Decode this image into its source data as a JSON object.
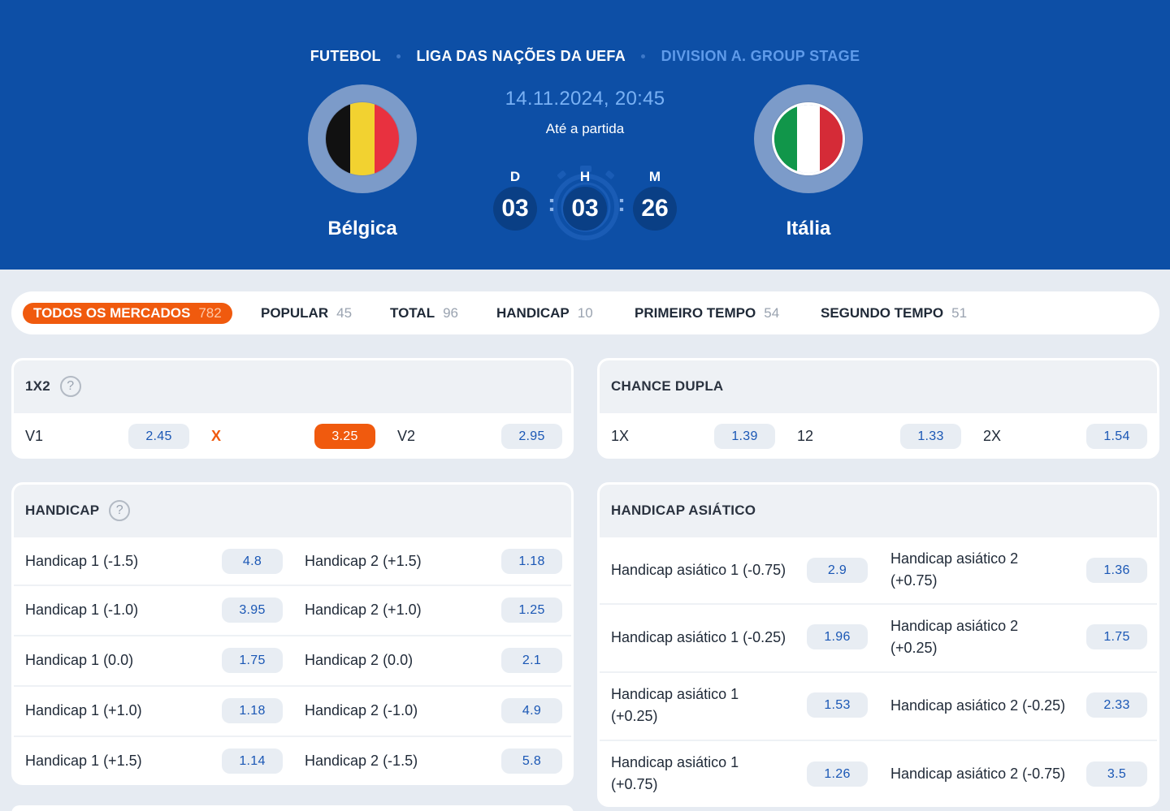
{
  "breadcrumb": [
    "FUTEBOL",
    "LIGA DAS NAÇÕES DA UEFA",
    "DIVISION A. GROUP STAGE"
  ],
  "match": {
    "datetime": "14.11.2024, 20:45",
    "until_label": "Até a partida",
    "home": {
      "name": "Bélgica",
      "flag_colors": [
        "#111111",
        "#f2d230",
        "#e8313f"
      ]
    },
    "away": {
      "name": "Itália",
      "flag_colors": [
        "#11964a",
        "#ffffff",
        "#d52b37"
      ]
    },
    "countdown": {
      "d_label": "D",
      "h_label": "H",
      "m_label": "M",
      "days": "03",
      "hours": "03",
      "minutes": "26",
      "separator": ":"
    }
  },
  "tabs": [
    {
      "label": "TODOS OS MERCADOS",
      "count": "782",
      "active": true
    },
    {
      "label": "POPULAR",
      "count": "45"
    },
    {
      "label": "TOTAL",
      "count": "96"
    },
    {
      "label": "HANDICAP",
      "count": "10"
    },
    {
      "label": "PRIMEIRO TEMPO",
      "count": "54"
    },
    {
      "label": "SEGUNDO TEMPO",
      "count": "51"
    }
  ],
  "markets": {
    "m1x2": {
      "title": "1X2",
      "help": "?",
      "outcomes": [
        {
          "label": "V1",
          "odd": "2.45"
        },
        {
          "label": "X",
          "odd": "3.25"
        },
        {
          "label": "V2",
          "odd": "2.95"
        }
      ]
    },
    "chance_dupla": {
      "title": "CHANCE DUPLA",
      "outcomes": [
        {
          "label": "1X",
          "odd": "1.39"
        },
        {
          "label": "12",
          "odd": "1.33"
        },
        {
          "label": "2X",
          "odd": "1.54"
        }
      ]
    },
    "handicap": {
      "title": "HANDICAP",
      "help": "?",
      "rows": [
        {
          "l": "Handicap 1 (-1.5)",
          "lo": "4.8",
          "r": "Handicap 2 (+1.5)",
          "ro": "1.18"
        },
        {
          "l": "Handicap 1 (-1.0)",
          "lo": "3.95",
          "r": "Handicap 2 (+1.0)",
          "ro": "1.25"
        },
        {
          "l": "Handicap 1 (0.0)",
          "lo": "1.75",
          "r": "Handicap 2 (0.0)",
          "ro": "2.1"
        },
        {
          "l": "Handicap 1 (+1.0)",
          "lo": "1.18",
          "r": "Handicap 2 (-1.0)",
          "ro": "4.9"
        },
        {
          "l": "Handicap 1 (+1.5)",
          "lo": "1.14",
          "r": "Handicap 2 (-1.5)",
          "ro": "5.8"
        }
      ]
    },
    "handicap_asiatico": {
      "title": "HANDICAP ASIÁTICO",
      "rows": [
        {
          "l": "Handicap asiático 1 (-0.75)",
          "lo": "2.9",
          "r1": "Handicap asiático 2",
          "r2": "(+0.75)",
          "ro": "1.36"
        },
        {
          "l": "Handicap asiático 1 (-0.25)",
          "lo": "1.96",
          "r1": "Handicap asiático 2",
          "r2": "(+0.25)",
          "ro": "1.75"
        },
        {
          "l1": "Handicap asiático 1",
          "l2": "(+0.25)",
          "lo": "1.53",
          "r": "Handicap asiático 2 (-0.25)",
          "ro": "2.33"
        },
        {
          "l1": "Handicap asiático 1",
          "l2": "(+0.75)",
          "lo": "1.26",
          "r": "Handicap asiático 2 (-0.75)",
          "ro": "3.5"
        }
      ]
    }
  }
}
